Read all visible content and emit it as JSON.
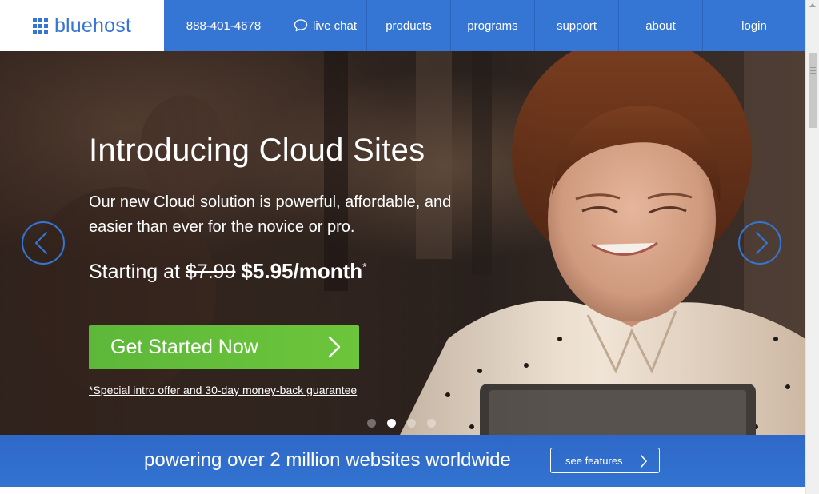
{
  "brand": {
    "name": "bluehost",
    "color": "#3575d3"
  },
  "nav": {
    "phone": "888-401-4678",
    "chat_label": "live chat",
    "items": [
      {
        "label": "products"
      },
      {
        "label": "programs"
      },
      {
        "label": "support"
      },
      {
        "label": "about"
      },
      {
        "label": "login"
      }
    ]
  },
  "hero": {
    "title": "Introducing Cloud Sites",
    "subtitle": "Our new Cloud solution is powerful, affordable, and easier than ever for the novice or pro.",
    "price_prefix": "Starting at",
    "old_price": "$7.99",
    "new_price": "$5.95/month",
    "price_mark": "*",
    "cta_label": "Get Started Now",
    "cta_color": "#6cc53a",
    "disclaimer": "*Special intro offer and 30-day money-back guarantee",
    "slides_total": 4,
    "active_slide": 2
  },
  "band": {
    "text": "powering over 2 million websites worldwide",
    "button_label": "see features"
  },
  "icons": [
    "logo-grid-icon",
    "chat-bubble-icon",
    "chevron-left-icon",
    "chevron-right-icon",
    "chevron-right-icon"
  ]
}
